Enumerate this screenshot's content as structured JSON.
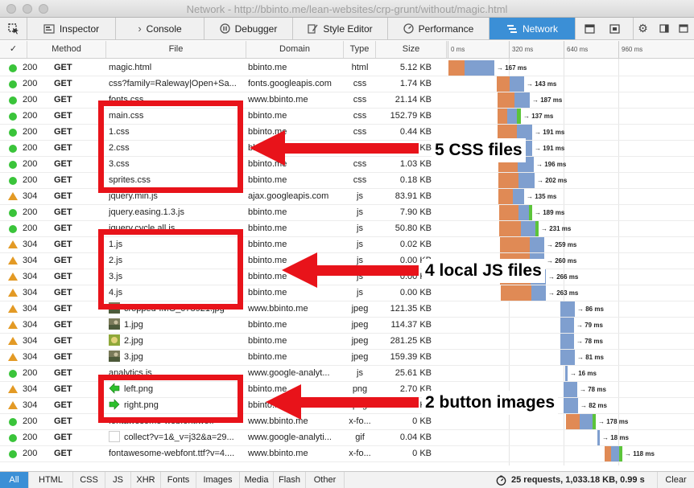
{
  "window": {
    "title": "Network - http://bbinto.me/lean-websites/crp-grunt/without/magic.html"
  },
  "toolbar": {
    "tabs": [
      {
        "label": "Inspector",
        "icon": "inspector-icon"
      },
      {
        "label": "Console",
        "icon": "console-icon"
      },
      {
        "label": "Debugger",
        "icon": "debugger-icon"
      },
      {
        "label": "Style Editor",
        "icon": "style-editor-icon"
      },
      {
        "label": "Performance",
        "icon": "performance-icon"
      },
      {
        "label": "Network",
        "icon": "network-icon",
        "active": true
      }
    ]
  },
  "columns": {
    "check": "✓",
    "method": "Method",
    "file": "File",
    "domain": "Domain",
    "type": "Type",
    "size": "Size"
  },
  "timeline": {
    "ticks": [
      "0 ms",
      "320 ms",
      "640 ms",
      "960 ms"
    ]
  },
  "requests": [
    {
      "status": "200",
      "method": "GET",
      "file": "magic.html",
      "domain": "bbinto.me",
      "type": "html",
      "size": "5.12 KB",
      "time": "→ 167 ms",
      "start": 0,
      "wait": 20,
      "recv": 37
    },
    {
      "status": "200",
      "method": "GET",
      "file": "css?family=Raleway|Open+Sa...",
      "domain": "fonts.googleapis.com",
      "type": "css",
      "size": "1.74 KB",
      "time": "→ 143 ms",
      "start": 60,
      "wait": 16,
      "recv": 18
    },
    {
      "status": "200",
      "method": "GET",
      "file": "fonts.css",
      "domain": "www.bbinto.me",
      "type": "css",
      "size": "21.14 KB",
      "time": "→ 187 ms",
      "start": 61,
      "wait": 21,
      "recv": 19
    },
    {
      "status": "200",
      "method": "GET",
      "file": "main.css",
      "domain": "bbinto.me",
      "type": "css",
      "size": "152.79 KB",
      "time": "→ 137 ms",
      "start": 61,
      "wait": 12,
      "recv": 14,
      "green": 5
    },
    {
      "status": "200",
      "method": "GET",
      "file": "1.css",
      "domain": "bbinto.me",
      "type": "css",
      "size": "0.44 KB",
      "time": "→ 191 ms",
      "start": 61,
      "wait": 24,
      "recv": 19
    },
    {
      "status": "200",
      "method": "GET",
      "file": "2.css",
      "domain": "bbinto.me",
      "type": "css",
      "size": "0.44 KB",
      "time": "→ 191 ms",
      "start": 61,
      "wait": 24,
      "recv": 19
    },
    {
      "status": "200",
      "method": "GET",
      "file": "3.css",
      "domain": "bbinto.me",
      "type": "css",
      "size": "1.03 KB",
      "time": "→ 196 ms",
      "start": 62,
      "wait": 24,
      "recv": 20
    },
    {
      "status": "200",
      "method": "GET",
      "file": "sprites.css",
      "domain": "bbinto.me",
      "type": "css",
      "size": "0.18 KB",
      "time": "→ 202 ms",
      "start": 62,
      "wait": 25,
      "recv": 20
    },
    {
      "status": "304",
      "method": "GET",
      "file": "jquery.min.js",
      "domain": "ajax.googleapis.com",
      "type": "js",
      "size": "83.91 KB",
      "time": "→ 135 ms",
      "start": 62,
      "wait": 18,
      "recv": 14
    },
    {
      "status": "200",
      "method": "GET",
      "file": "jquery.easing.1.3.js",
      "domain": "bbinto.me",
      "type": "js",
      "size": "7.90 KB",
      "time": "→ 189 ms",
      "start": 63,
      "wait": 24,
      "recv": 15,
      "green": 4
    },
    {
      "status": "200",
      "method": "GET",
      "file": "jquery.cycle.all.js",
      "domain": "bbinto.me",
      "type": "js",
      "size": "50.80 KB",
      "time": "→ 231 ms",
      "start": 63,
      "wait": 27,
      "recv": 20,
      "green": 4
    },
    {
      "status": "304",
      "method": "GET",
      "file": "1.js",
      "domain": "bbinto.me",
      "type": "js",
      "size": "0.02 KB",
      "time": "→ 259 ms",
      "start": 64,
      "wait": 37,
      "recv": 18
    },
    {
      "status": "304",
      "method": "GET",
      "file": "2.js",
      "domain": "bbinto.me",
      "type": "js",
      "size": "0.00 KB",
      "time": "→ 260 ms",
      "start": 64,
      "wait": 37,
      "recv": 18
    },
    {
      "status": "304",
      "method": "GET",
      "file": "3.js",
      "domain": "bbinto.me",
      "type": "js",
      "size": "0.00 KB",
      "time": "→ 266 ms",
      "start": 64,
      "wait": 38,
      "recv": 19
    },
    {
      "status": "304",
      "method": "GET",
      "file": "4.js",
      "domain": "bbinto.me",
      "type": "js",
      "size": "0.00 KB",
      "time": "→ 263 ms",
      "start": 65,
      "wait": 38,
      "recv": 18
    },
    {
      "status": "304",
      "method": "GET",
      "file": "cropped-IMG_078921.jpg",
      "domain": "www.bbinto.me",
      "type": "jpeg",
      "size": "121.35 KB",
      "time": "→ 86 ms",
      "start": 139,
      "wait": 0,
      "recv": 18,
      "thumb": "photo"
    },
    {
      "status": "304",
      "method": "GET",
      "file": "1.jpg",
      "domain": "bbinto.me",
      "type": "jpeg",
      "size": "114.37 KB",
      "time": "→ 79 ms",
      "start": 139,
      "wait": 0,
      "recv": 17,
      "thumb": "photo"
    },
    {
      "status": "304",
      "method": "GET",
      "file": "2.jpg",
      "domain": "bbinto.me",
      "type": "jpeg",
      "size": "281.25 KB",
      "time": "→ 78 ms",
      "start": 139,
      "wait": 0,
      "recv": 17,
      "thumb": "photo2"
    },
    {
      "status": "304",
      "method": "GET",
      "file": "3.jpg",
      "domain": "bbinto.me",
      "type": "jpeg",
      "size": "159.39 KB",
      "time": "→ 81 ms",
      "start": 139,
      "wait": 0,
      "recv": 18,
      "thumb": "photo"
    },
    {
      "status": "200",
      "method": "GET",
      "file": "analytics.js",
      "domain": "www.google-analyt...",
      "type": "js",
      "size": "25.61 KB",
      "time": "→ 16 ms",
      "start": 145,
      "wait": 0,
      "recv": 3
    },
    {
      "status": "304",
      "method": "GET",
      "file": "left.png",
      "domain": "bbinto.me",
      "type": "png",
      "size": "2.70 KB",
      "time": "→ 78 ms",
      "start": 143,
      "wait": 0,
      "recv": 17,
      "thumb": "left-arrow"
    },
    {
      "status": "304",
      "method": "GET",
      "file": "right.png",
      "domain": "bbinto.me",
      "type": "png",
      "size": "2.69 KB",
      "time": "→ 82 ms",
      "start": 143,
      "wait": 0,
      "recv": 18,
      "thumb": "right-arrow"
    },
    {
      "status": "200",
      "method": "GET",
      "file": "fontawesome-webfont.woff",
      "domain": "www.bbinto.me",
      "type": "x-fo...",
      "size": "0 KB",
      "time": "→ 178 ms",
      "start": 146,
      "wait": 17,
      "recv": 18,
      "green": 4
    },
    {
      "status": "200",
      "method": "GET",
      "file": "collect?v=1&_v=j32&a=29...",
      "domain": "www.google-analyti...",
      "type": "gif",
      "size": "0.04 KB",
      "time": "→ 18 ms",
      "start": 185,
      "wait": 0,
      "recv": 3,
      "thumb": "blank"
    },
    {
      "status": "200",
      "method": "GET",
      "file": "fontawesome-webfont.ttf?v=4....",
      "domain": "www.bbinto.me",
      "type": "x-fo...",
      "size": "0 KB",
      "time": "→ 118 ms",
      "start": 194,
      "wait": 8,
      "recv": 12,
      "green": 4
    }
  ],
  "footer": {
    "filters": [
      "All",
      "HTML",
      "CSS",
      "JS",
      "XHR",
      "Fonts",
      "Images",
      "Media",
      "Flash",
      "Other"
    ],
    "summary": "25 requests, 1,033.18 KB, 0.99 s",
    "clear": "Clear"
  },
  "annotations": {
    "css": "5 CSS files",
    "js": "4 local JS files",
    "images": "2 button images"
  },
  "colors": {
    "accent": "#3b8fd6",
    "annotation": "#e8131a",
    "ok": "#3ac43a",
    "cached": "#e39a25",
    "wait": "#e08a55",
    "recv": "#7f9fcf",
    "load": "#5cc43a"
  }
}
